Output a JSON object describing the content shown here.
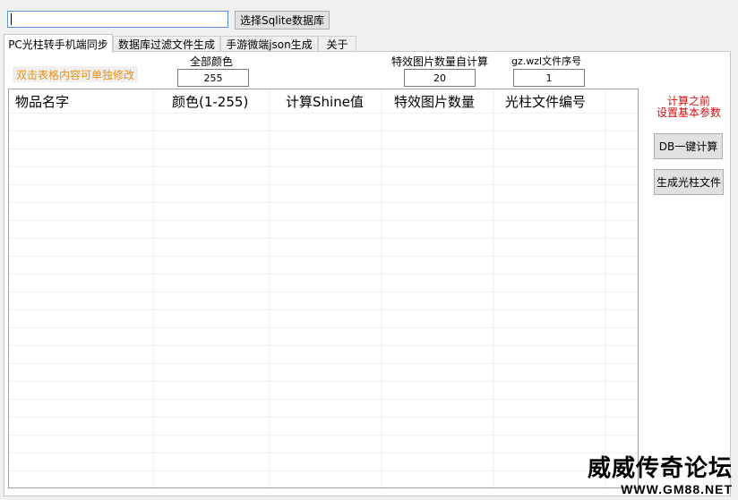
{
  "toolbar": {
    "path_value": "",
    "select_db_label": "选择Sqlite数据库"
  },
  "tabs": [
    {
      "label": "PC光柱转手机端同步",
      "active": true
    },
    {
      "label": "数据库过滤文件生成",
      "active": false
    },
    {
      "label": "手游微端json生成",
      "active": false
    },
    {
      "label": "关于",
      "active": false
    }
  ],
  "panel": {
    "hint": "双击表格内容可单独修改",
    "all_color_label": "全部颜色",
    "all_color_value": "255",
    "effect_count_label": "特效图片数量自计算",
    "effect_count_value": "20",
    "file_index_label": "gz.wzl文件序号",
    "file_index_value": "1",
    "columns": [
      "物品名字",
      "颜色(1-255)",
      "计算Shine值",
      "特效图片数量",
      "光柱文件编号"
    ],
    "note_line1": "计算之前",
    "note_line2": "设置基本参数",
    "calc_button": "DB一键计算",
    "generate_button": "生成光柱文件"
  },
  "watermark": {
    "title": "威威传奇论坛",
    "url": "WWW.GM88.NET"
  },
  "colors": {
    "hint_text": "#e69218",
    "note_text": "#d01010",
    "input_focus_border": "#5b8fd6"
  }
}
